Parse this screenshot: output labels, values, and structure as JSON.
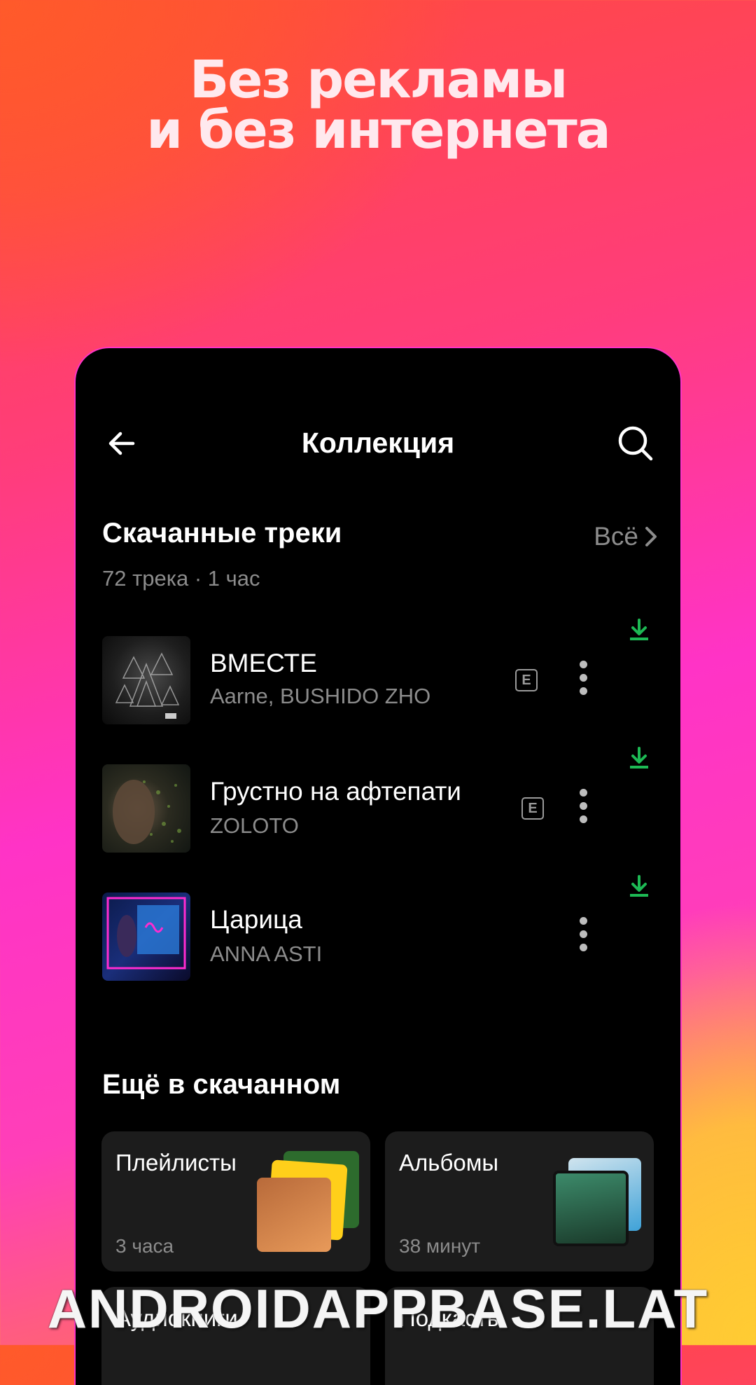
{
  "promo": {
    "headline_line1": "Без рекламы",
    "headline_line2": "и без интернета"
  },
  "header": {
    "title": "Коллекция",
    "back_icon": "arrow-left-icon",
    "search_icon": "search-icon"
  },
  "downloaded": {
    "title": "Скачанные треки",
    "all_label": "Всё",
    "summary": "72 трека · 1 час",
    "tracks": [
      {
        "title": "ВМЕСТЕ",
        "artist": "Aarne, BUSHIDO ZHO",
        "explicit": "E"
      },
      {
        "title": "Грустно на афтепати",
        "artist": "ZOLOTO",
        "explicit": "E"
      },
      {
        "title": "Царица",
        "artist": "ANNA ASTI"
      }
    ]
  },
  "more_downloaded": {
    "title": "Ещё в скачанном",
    "cards": [
      {
        "title": "Плейлисты",
        "subtitle": "3 часа"
      },
      {
        "title": "Альбомы",
        "subtitle": "38 минут"
      },
      {
        "title": "Аудиокниги"
      },
      {
        "title": "Подкасты"
      }
    ]
  },
  "colors": {
    "download_green": "#1db954",
    "text_secondary": "#8c8c8c"
  },
  "watermark": "ANDROIDAPPBASE.LAT"
}
